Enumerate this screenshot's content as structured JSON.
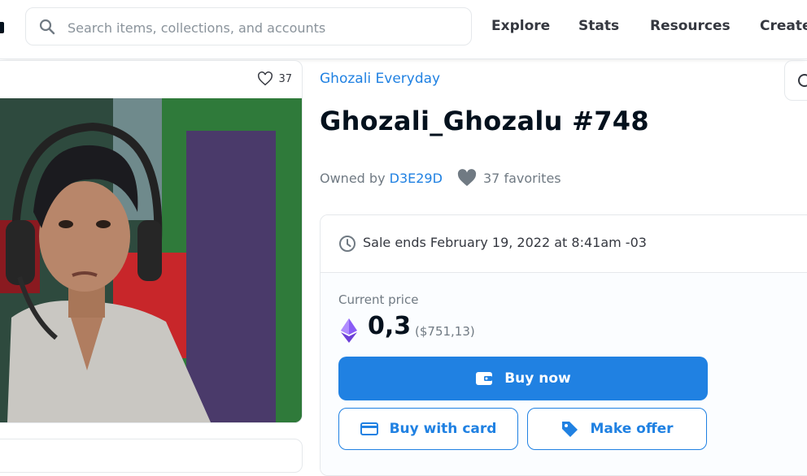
{
  "search": {
    "placeholder": "Search items, collections, and accounts"
  },
  "nav": {
    "explore": "Explore",
    "stats": "Stats",
    "resources": "Resources",
    "create": "Create"
  },
  "item": {
    "favorites_count": "37",
    "collection": "Ghozali Everyday",
    "title": "Ghozali_Ghozalu #748",
    "owned_by_label": "Owned by",
    "owner": "D3E29D",
    "favorites_label": "37 favorites"
  },
  "sale": {
    "ends": "Sale ends February 19, 2022 at 8:41am -03",
    "current_price_label": "Current price",
    "price": "0,3",
    "price_usd": "($751,13)",
    "buy_now": "Buy now",
    "buy_with_card": "Buy with card",
    "make_offer": "Make offer"
  },
  "icons": [
    "search-icon",
    "heart-outline-icon",
    "heart-icon",
    "clock-icon",
    "eth-icon",
    "wallet-icon",
    "credit-card-icon",
    "tag-icon",
    "refresh-icon"
  ],
  "colors": {
    "accent": "#2081e2",
    "text": "#04111d",
    "muted": "#707a83"
  }
}
